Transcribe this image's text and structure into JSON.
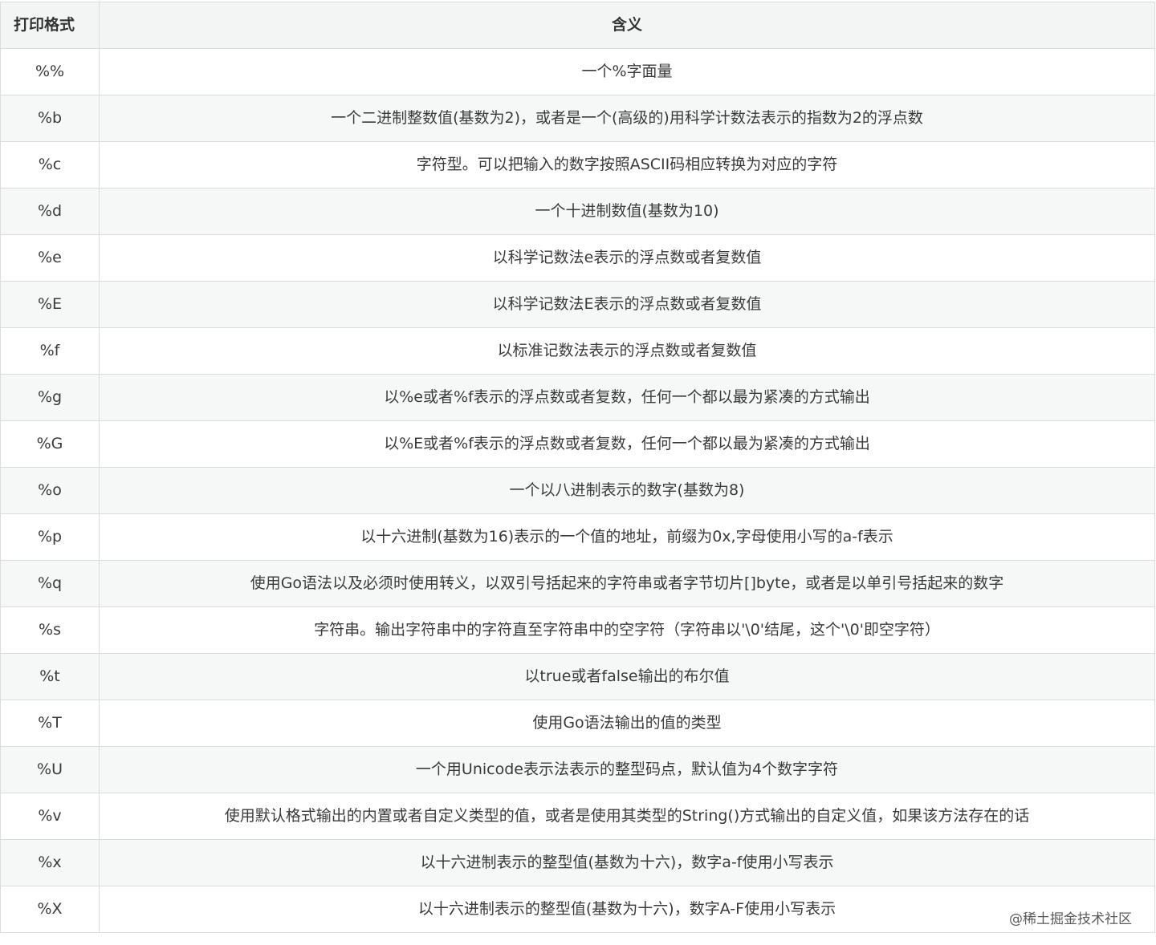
{
  "table": {
    "headers": [
      "打印格式",
      "含义"
    ],
    "rows": [
      [
        "%%",
        "一个%字面量"
      ],
      [
        "%b",
        "一个二进制整数值(基数为2)，或者是一个(高级的)用科学计数法表示的指数为2的浮点数"
      ],
      [
        "%c",
        "字符型。可以把输入的数字按照ASCII码相应转换为对应的字符"
      ],
      [
        "%d",
        "一个十进制数值(基数为10)"
      ],
      [
        "%e",
        "以科学记数法e表示的浮点数或者复数值"
      ],
      [
        "%E",
        "以科学记数法E表示的浮点数或者复数值"
      ],
      [
        "%f",
        "以标准记数法表示的浮点数或者复数值"
      ],
      [
        "%g",
        "以%e或者%f表示的浮点数或者复数，任何一个都以最为紧凑的方式输出"
      ],
      [
        "%G",
        "以%E或者%f表示的浮点数或者复数，任何一个都以最为紧凑的方式输出"
      ],
      [
        "%o",
        "一个以八进制表示的数字(基数为8)"
      ],
      [
        "%p",
        "以十六进制(基数为16)表示的一个值的地址，前缀为0x,字母使用小写的a-f表示"
      ],
      [
        "%q",
        "使用Go语法以及必须时使用转义，以双引号括起来的字符串或者字节切片[]byte，或者是以单引号括起来的数字"
      ],
      [
        "%s",
        "字符串。输出字符串中的字符直至字符串中的空字符（字符串以'\\0'结尾，这个'\\0'即空字符）"
      ],
      [
        "%t",
        "以true或者false输出的布尔值"
      ],
      [
        "%T",
        "使用Go语法输出的值的类型"
      ],
      [
        "%U",
        "一个用Unicode表示法表示的整型码点，默认值为4个数字字符"
      ],
      [
        "%v",
        "使用默认格式输出的内置或者自定义类型的值，或者是使用其类型的String()方式输出的自定义值，如果该方法存在的话"
      ],
      [
        "%x",
        "以十六进制表示的整型值(基数为十六)，数字a-f使用小写表示"
      ],
      [
        "%X",
        "以十六进制表示的整型值(基数为十六)，数字A-F使用小写表示"
      ]
    ]
  },
  "watermark": "@稀土掘金技术社区"
}
